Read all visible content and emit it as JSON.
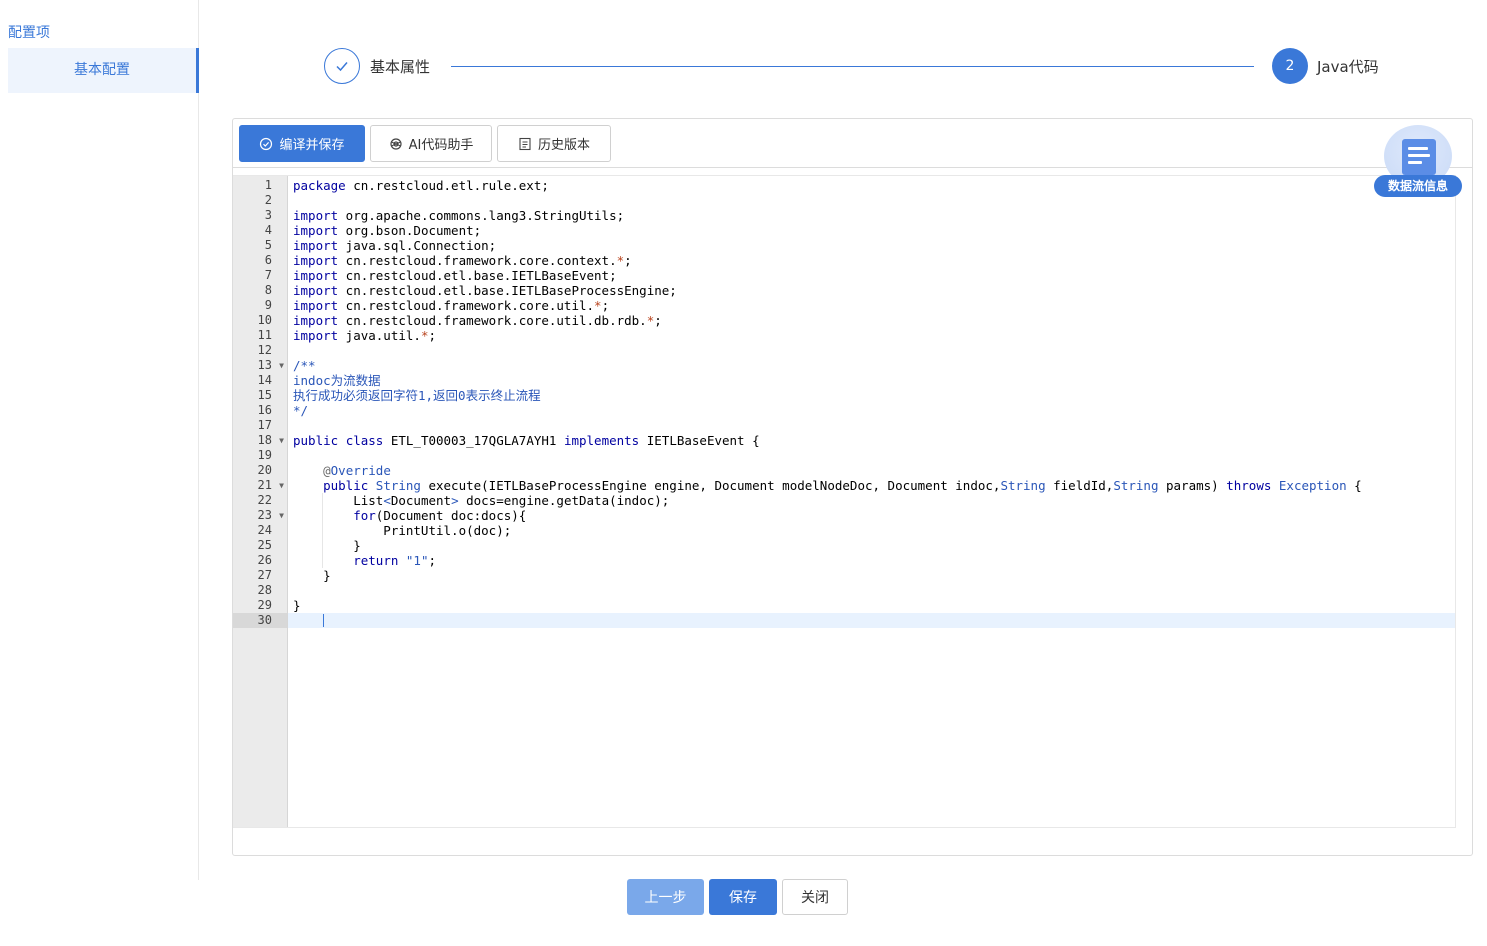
{
  "sidebar": {
    "title": "配置项",
    "items": [
      {
        "label": "基本配置"
      }
    ]
  },
  "steps": [
    {
      "label": "基本属性",
      "icon": "check-icon"
    },
    {
      "number": "2",
      "label": "Java代码"
    }
  ],
  "toolbar": {
    "compile_label": "编译并保存",
    "ai_label": "AI代码助手",
    "history_label": "历史版本"
  },
  "badge": {
    "label": "数据流信息"
  },
  "editor": {
    "current_line": 30,
    "lines": [
      "package cn.restcloud.etl.rule.ext;",
      "",
      "import org.apache.commons.lang3.StringUtils;",
      "import org.bson.Document;",
      "import java.sql.Connection;",
      "import cn.restcloud.framework.core.context.*;",
      "import cn.restcloud.etl.base.IETLBaseEvent;",
      "import cn.restcloud.etl.base.IETLBaseProcessEngine;",
      "import cn.restcloud.framework.core.util.*;",
      "import cn.restcloud.framework.core.util.db.rdb.*;",
      "import java.util.*;",
      "",
      "/**",
      "indoc为流数据",
      "执行成功必须返回字符1,返回0表示终止流程",
      "*/",
      "",
      "public class ETL_T00003_17QGLA7AYH1 implements IETLBaseEvent {",
      "",
      "    @Override",
      "    public String execute(IETLBaseProcessEngine engine, Document modelNodeDoc, Document indoc,String fieldId,String params) throws Exception {",
      "        List<Document> docs=engine.getData(indoc);",
      "        for(Document doc:docs){",
      "            PrintUtil.o(doc);",
      "        }",
      "        return \"1\";",
      "    }",
      "",
      "}",
      ""
    ],
    "fold_lines": [
      13,
      18,
      21,
      23
    ]
  },
  "footer": {
    "prev_label": "上一步",
    "save_label": "保存",
    "close_label": "关闭"
  },
  "colors": {
    "accent": "#3a78d8",
    "keyword": "#0000a0",
    "comment": "#2a56b8"
  }
}
